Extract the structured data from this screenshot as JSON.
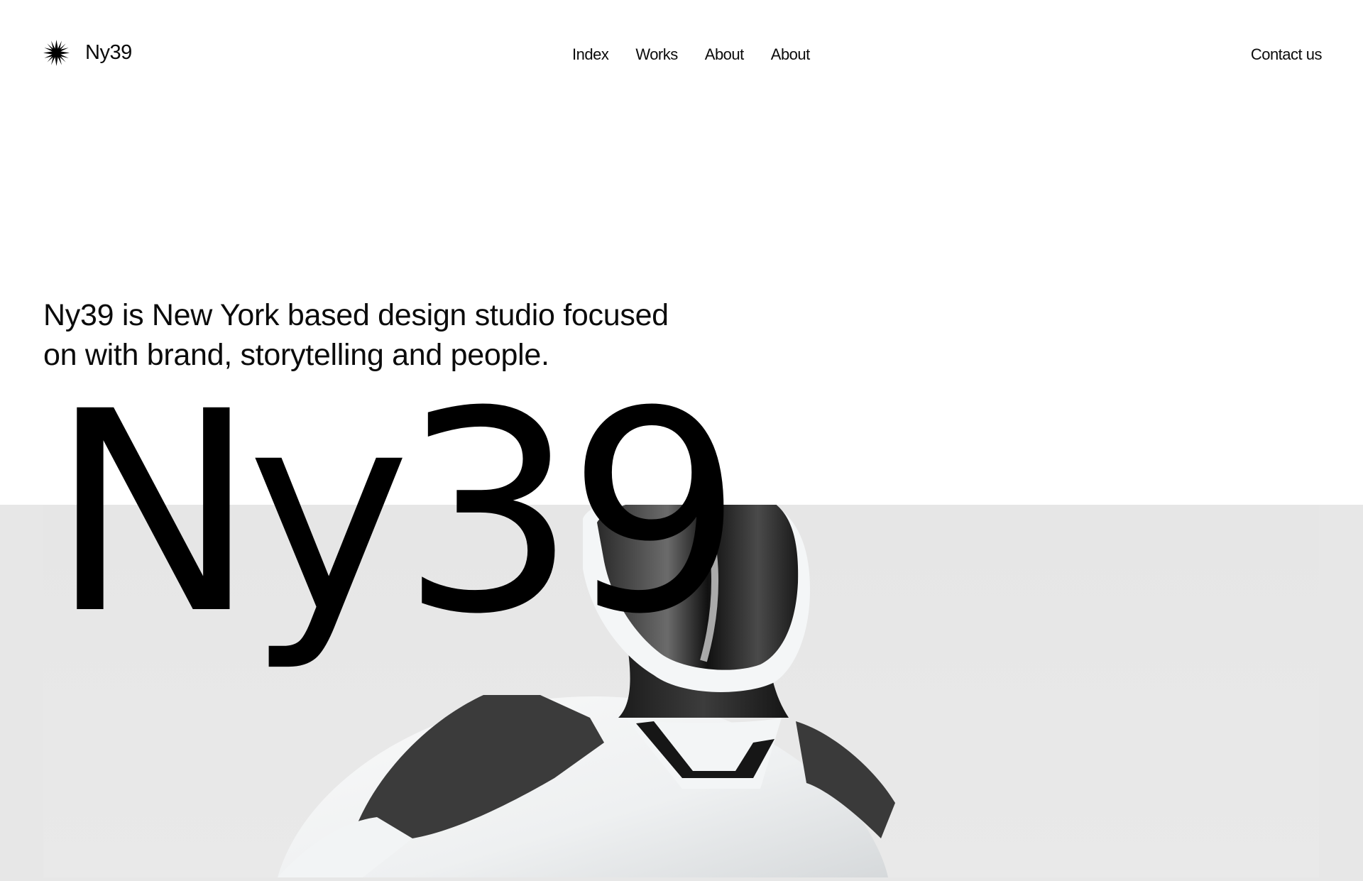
{
  "header": {
    "brand_name": "Ny39",
    "brand_icon": "starburst-icon",
    "nav": [
      {
        "label": "Index"
      },
      {
        "label": "Works"
      },
      {
        "label": "About"
      },
      {
        "label": "About"
      }
    ],
    "contact_label": "Contact us"
  },
  "hero": {
    "intro": "Ny39 is New York based design studio focused on with brand, storytelling and people.",
    "wordmark": "Ny39",
    "image": {
      "subject": "robot-figure",
      "band_color": "#e7e7e7"
    }
  },
  "colors": {
    "text": "#0b0b0b",
    "background": "#ffffff",
    "band": "#e7e7e7"
  }
}
